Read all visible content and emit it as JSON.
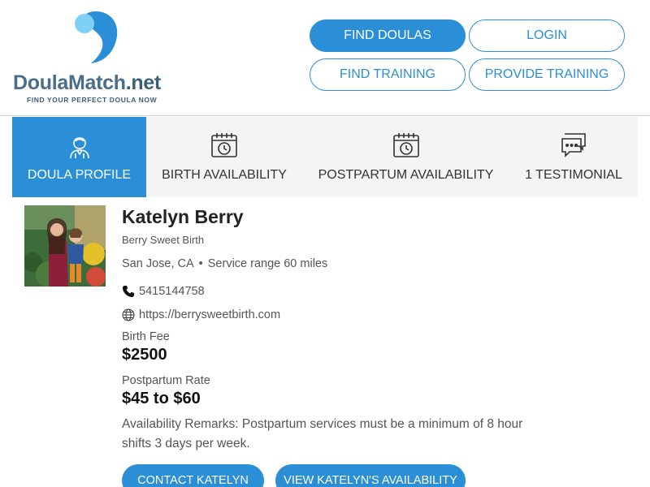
{
  "brand": {
    "name_main": "DoulaMatch",
    "name_suffix": ".net",
    "tagline": "FIND YOUR PERFECT DOULA NOW",
    "accent_color": "#2a8fd6"
  },
  "nav": {
    "find_doulas": "FIND DOULAS",
    "login": "LOGIN",
    "find_training": "FIND TRAINING",
    "provide_training": "PROVIDE TRAINING"
  },
  "tabs": [
    {
      "label": "DOULA PROFILE",
      "icon": "doula-person-icon",
      "active": true
    },
    {
      "label": "BIRTH AVAILABILITY",
      "icon": "calendar-clock-icon",
      "active": false
    },
    {
      "label": "POSTPARTUM AVAILABILITY",
      "icon": "calendar-clock-icon",
      "active": false
    },
    {
      "label": "1 TESTIMONIAL",
      "icon": "chat-bubbles-icon",
      "active": false
    }
  ],
  "profile": {
    "name": "Katelyn Berry",
    "business": "Berry Sweet Birth",
    "city": "San Jose, CA",
    "service_range": "Service range 60 miles",
    "phone": "5415144758",
    "website": "https://berrysweetbirth.com",
    "birth_fee_label": "Birth Fee",
    "birth_fee": "$2500",
    "postpartum_rate_label": "Postpartum Rate",
    "postpartum_rate": "$45 to $60",
    "remarks": "Availability Remarks: Postpartum services must be a minimum of 8 hour shifts 3 days per week."
  },
  "actions": {
    "contact": "CONTACT KATELYN",
    "availability": "VIEW KATELYN'S AVAILABILITY"
  }
}
